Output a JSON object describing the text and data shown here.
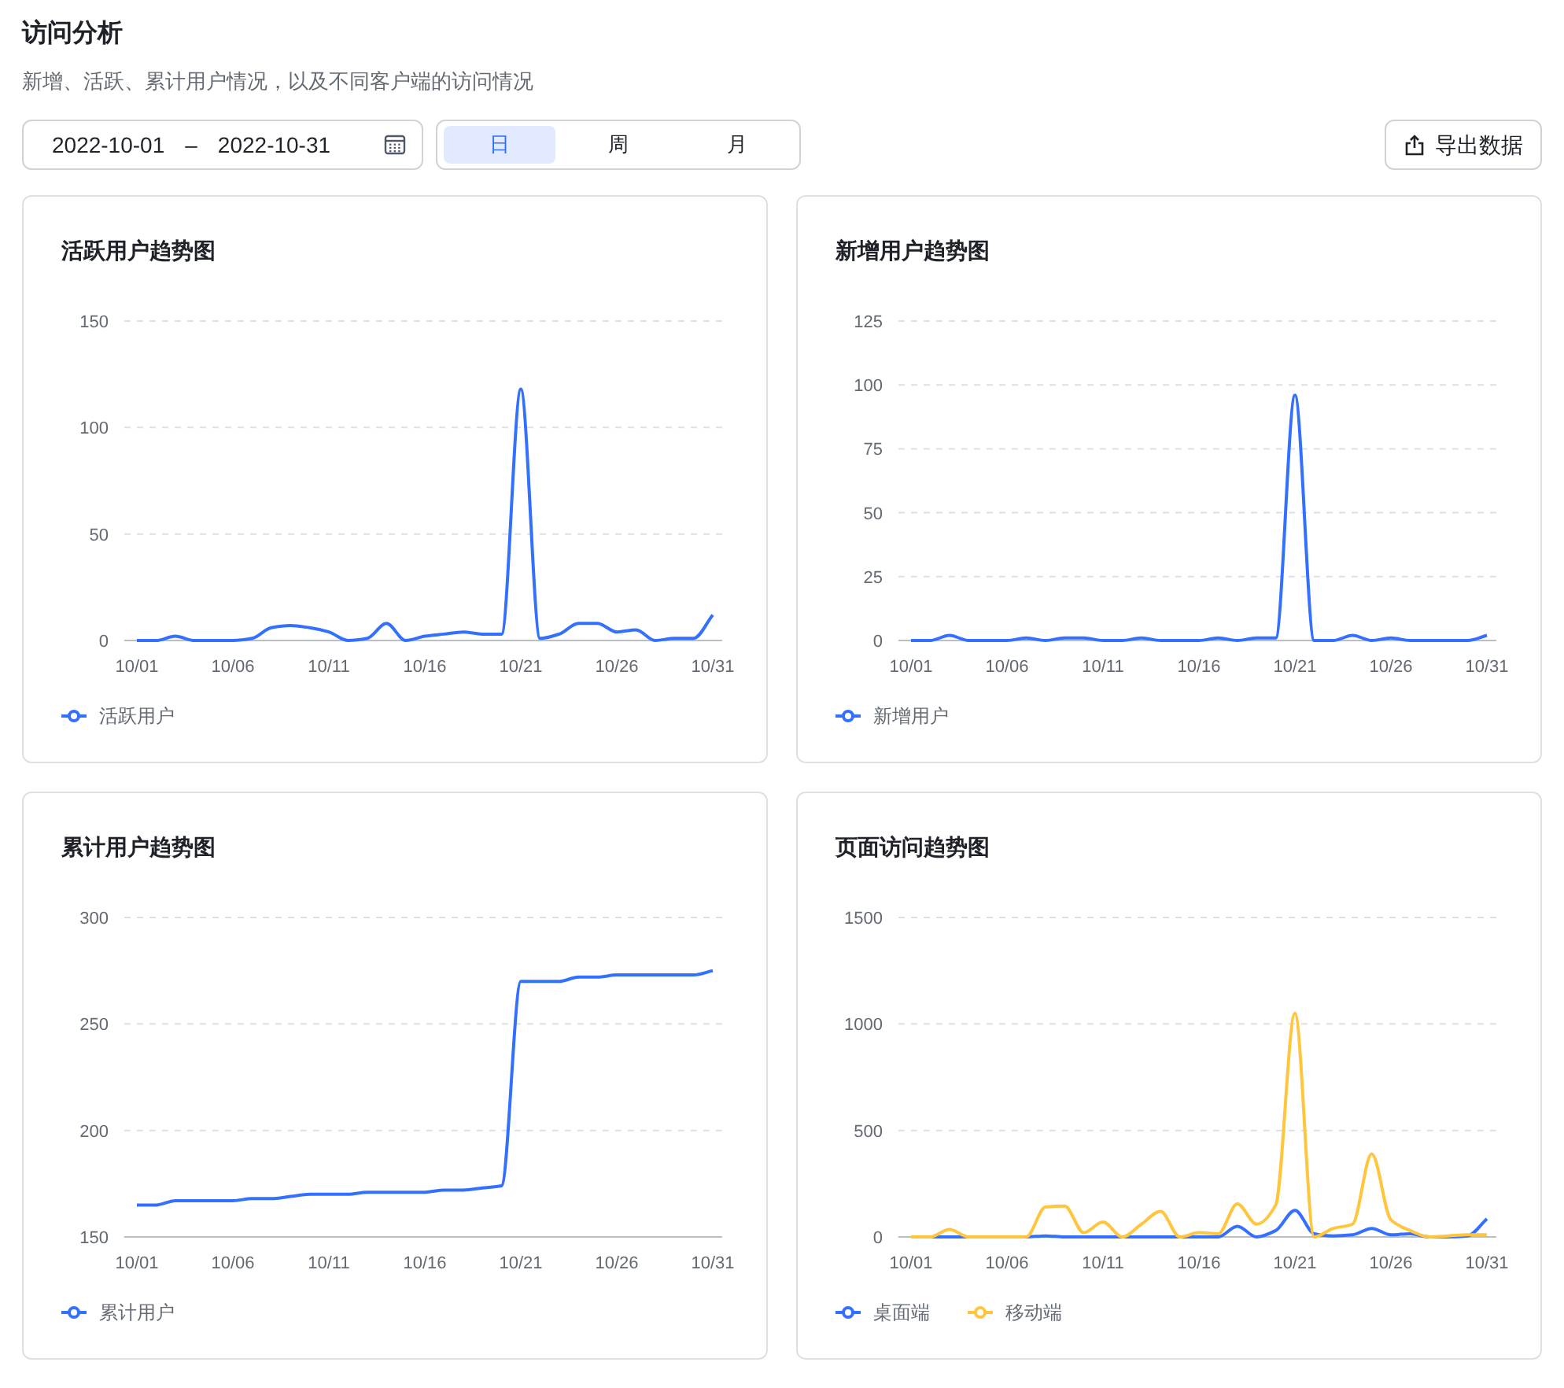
{
  "header": {
    "title": "访问分析",
    "subtitle": "新增、活跃、累计用户情况，以及不同客户端的访问情况"
  },
  "toolbar": {
    "date_range": {
      "start": "2022-10-01",
      "separator": "–",
      "end": "2022-10-31"
    },
    "periods": [
      {
        "label": "日",
        "selected": true
      },
      {
        "label": "周",
        "selected": false
      },
      {
        "label": "月",
        "selected": false
      }
    ],
    "export_button": "导出数据"
  },
  "charts": [
    {
      "title": "活跃用户趋势图",
      "chart_data": {
        "type": "line",
        "categories": [
          "10/01",
          null,
          null,
          null,
          null,
          "10/06",
          null,
          null,
          null,
          null,
          "10/11",
          null,
          null,
          null,
          null,
          "10/16",
          null,
          null,
          null,
          null,
          "10/21",
          null,
          null,
          null,
          null,
          "10/26",
          null,
          null,
          null,
          null,
          "10/31"
        ],
        "grid": true,
        "ylim": [
          0,
          150
        ],
        "yticks": [
          0,
          50,
          100,
          150
        ],
        "series": [
          {
            "name": "活跃用户",
            "color": "#3370ff",
            "values": [
              0,
              0,
              2,
              0,
              0,
              0,
              1,
              6,
              7,
              6,
              4,
              0,
              1,
              8,
              0,
              2,
              3,
              4,
              3,
              3,
              118,
              1,
              3,
              8,
              8,
              4,
              5,
              0,
              1,
              1,
              12
            ]
          }
        ]
      }
    },
    {
      "title": "新增用户趋势图",
      "chart_data": {
        "type": "line",
        "categories": [
          "10/01",
          null,
          null,
          null,
          null,
          "10/06",
          null,
          null,
          null,
          null,
          "10/11",
          null,
          null,
          null,
          null,
          "10/16",
          null,
          null,
          null,
          null,
          "10/21",
          null,
          null,
          null,
          null,
          "10/26",
          null,
          null,
          null,
          null,
          "10/31"
        ],
        "grid": true,
        "ylim": [
          0,
          125
        ],
        "yticks": [
          0,
          25,
          50,
          75,
          100,
          125
        ],
        "series": [
          {
            "name": "新增用户",
            "color": "#3370ff",
            "values": [
              0,
              0,
              2,
              0,
              0,
              0,
              1,
              0,
              1,
              1,
              0,
              0,
              1,
              0,
              0,
              0,
              1,
              0,
              1,
              1,
              96,
              0,
              0,
              2,
              0,
              1,
              0,
              0,
              0,
              0,
              2
            ]
          }
        ]
      }
    },
    {
      "title": "累计用户趋势图",
      "chart_data": {
        "type": "line",
        "categories": [
          "10/01",
          null,
          null,
          null,
          null,
          "10/06",
          null,
          null,
          null,
          null,
          "10/11",
          null,
          null,
          null,
          null,
          "10/16",
          null,
          null,
          null,
          null,
          "10/21",
          null,
          null,
          null,
          null,
          "10/26",
          null,
          null,
          null,
          null,
          "10/31"
        ],
        "grid": true,
        "ylim": [
          150,
          300
        ],
        "yticks": [
          150,
          200,
          250,
          300
        ],
        "series": [
          {
            "name": "累计用户",
            "color": "#3370ff",
            "values": [
              165,
              165,
              167,
              167,
              167,
              167,
              168,
              168,
              169,
              170,
              170,
              170,
              171,
              171,
              171,
              171,
              172,
              172,
              173,
              174,
              270,
              270,
              270,
              272,
              272,
              273,
              273,
              273,
              273,
              273,
              275
            ]
          }
        ]
      }
    },
    {
      "title": "页面访问趋势图",
      "chart_data": {
        "type": "line",
        "categories": [
          "10/01",
          null,
          null,
          null,
          null,
          "10/06",
          null,
          null,
          null,
          null,
          "10/11",
          null,
          null,
          null,
          null,
          "10/16",
          null,
          null,
          null,
          null,
          "10/21",
          null,
          null,
          null,
          null,
          "10/26",
          null,
          null,
          null,
          null,
          "10/31"
        ],
        "grid": true,
        "ylim": [
          0,
          1500
        ],
        "yticks": [
          0,
          500,
          1000,
          1500
        ],
        "series": [
          {
            "name": "桌面端",
            "color": "#3370ff",
            "values": [
              0,
              0,
              0,
              0,
              0,
              0,
              0,
              5,
              0,
              0,
              0,
              0,
              0,
              0,
              0,
              0,
              0,
              50,
              0,
              30,
              125,
              15,
              5,
              10,
              40,
              10,
              15,
              0,
              0,
              5,
              85
            ]
          },
          {
            "name": "移动端",
            "color": "#ffc53d",
            "values": [
              0,
              0,
              35,
              0,
              0,
              0,
              0,
              140,
              145,
              20,
              70,
              0,
              60,
              120,
              0,
              20,
              15,
              155,
              60,
              150,
              1050,
              0,
              40,
              60,
              390,
              80,
              30,
              0,
              5,
              10,
              10
            ]
          }
        ]
      }
    }
  ]
}
